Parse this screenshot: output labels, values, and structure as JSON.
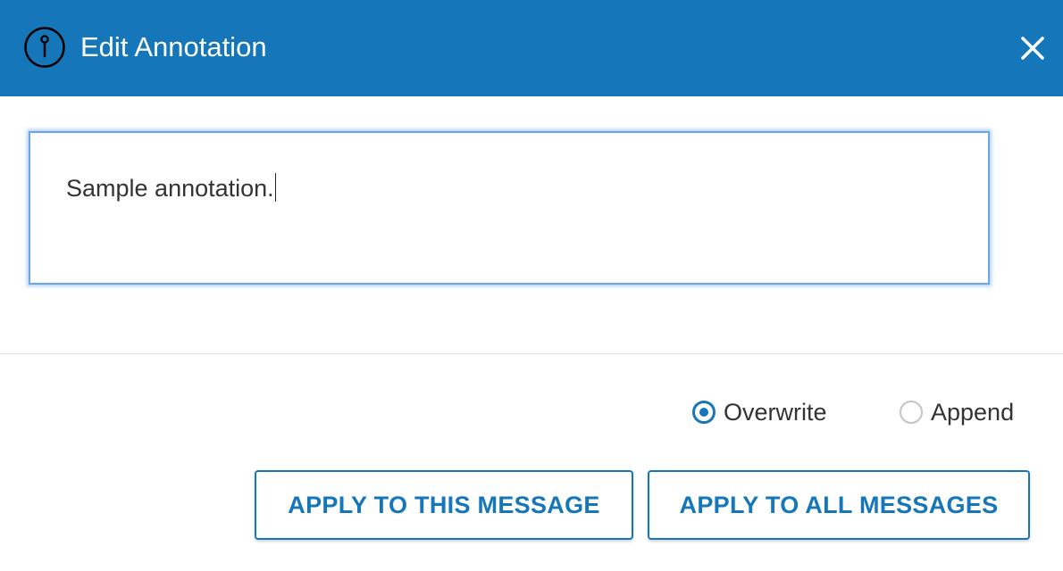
{
  "dialog": {
    "title": "Edit Annotation",
    "title_icon": "info-icon",
    "close_icon": "close-icon"
  },
  "annotation": {
    "value": "Sample annotation."
  },
  "mode": {
    "options": [
      {
        "label": "Overwrite",
        "selected": true
      },
      {
        "label": "Append",
        "selected": false
      }
    ]
  },
  "actions": {
    "apply_this_label": "APPLY TO THIS MESSAGE",
    "apply_all_label": "APPLY TO ALL MESSAGES"
  },
  "colors": {
    "header_bg": "#1577ba",
    "accent": "#1577ba",
    "focus_ring": "#6aa6ea"
  }
}
